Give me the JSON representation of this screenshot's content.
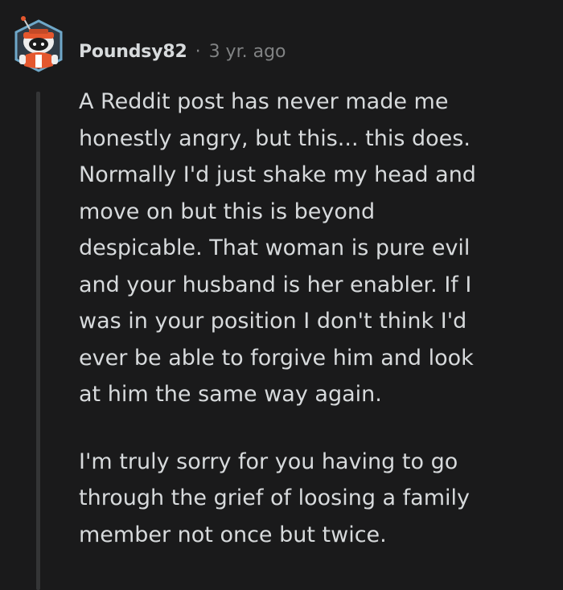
{
  "comment": {
    "username": "Poundsy82",
    "separator": "·",
    "timestamp": "3 yr. ago",
    "paragraphs": [
      "A Reddit post has never made me\nhonestly angry, but this... this does.\nNormally I'd just shake my head and\nmove on but this is beyond\ndespicable. That woman is pure evil\nand your husband is her enabler. If I\nwas in your position I don't think I'd\never be able to forgive him and look\nat him the same way again.",
      "I'm truly sorry for you having to go\nthrough the grief of loosing a family\nmember not once but twice."
    ],
    "avatar_icon": "snoo-avatar-icon",
    "colors": {
      "background": "#1a1a1b",
      "text": "#d7dadc",
      "meta": "#818384",
      "thread_line": "#343536",
      "avatar_accent": "#e4572e"
    }
  }
}
